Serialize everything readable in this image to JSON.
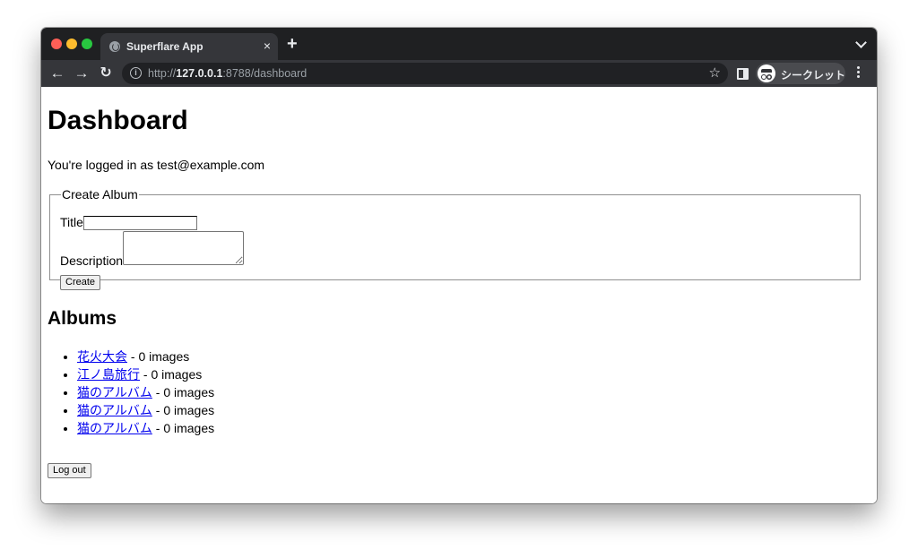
{
  "browser": {
    "tab_title": "Superflare App",
    "tab_close": "×",
    "new_tab": "+",
    "url_scheme": "http://",
    "url_host": "127.0.0.1",
    "url_rest": ":8788/dashboard",
    "profile_label": "シークレット"
  },
  "page": {
    "heading": "Dashboard",
    "logged_in_text": "You're logged in as test@example.com",
    "form": {
      "legend": "Create Album",
      "title_label": "Title",
      "title_value": "",
      "description_label": "Description",
      "description_value": "",
      "create_button": "Create"
    },
    "albums_heading": "Albums",
    "albums": [
      {
        "name": "花火大会",
        "count": " - 0 images"
      },
      {
        "name": "江ノ島旅行",
        "count": " - 0 images"
      },
      {
        "name": "猫のアルバム",
        "count": " - 0 images"
      },
      {
        "name": "猫のアルバム",
        "count": " - 0 images"
      },
      {
        "name": "猫のアルバム",
        "count": " - 0 images"
      }
    ],
    "logout_button": "Log out"
  },
  "icons": {
    "window_controls": [
      "close-icon",
      "minimize-icon",
      "maximize-icon"
    ],
    "toolbar": [
      "back-arrow-icon",
      "forward-arrow-icon",
      "reload-icon",
      "site-info-icon",
      "bookmark-star-icon",
      "side-panel-icon",
      "incognito-icon",
      "kebab-menu-icon"
    ]
  },
  "colors": {
    "chrome_dark": "#1f2022",
    "toolbar": "#35363a",
    "link": "#0000ee",
    "traffic_red": "#fe5f57",
    "traffic_yellow": "#febc2e",
    "traffic_green": "#28c840"
  }
}
